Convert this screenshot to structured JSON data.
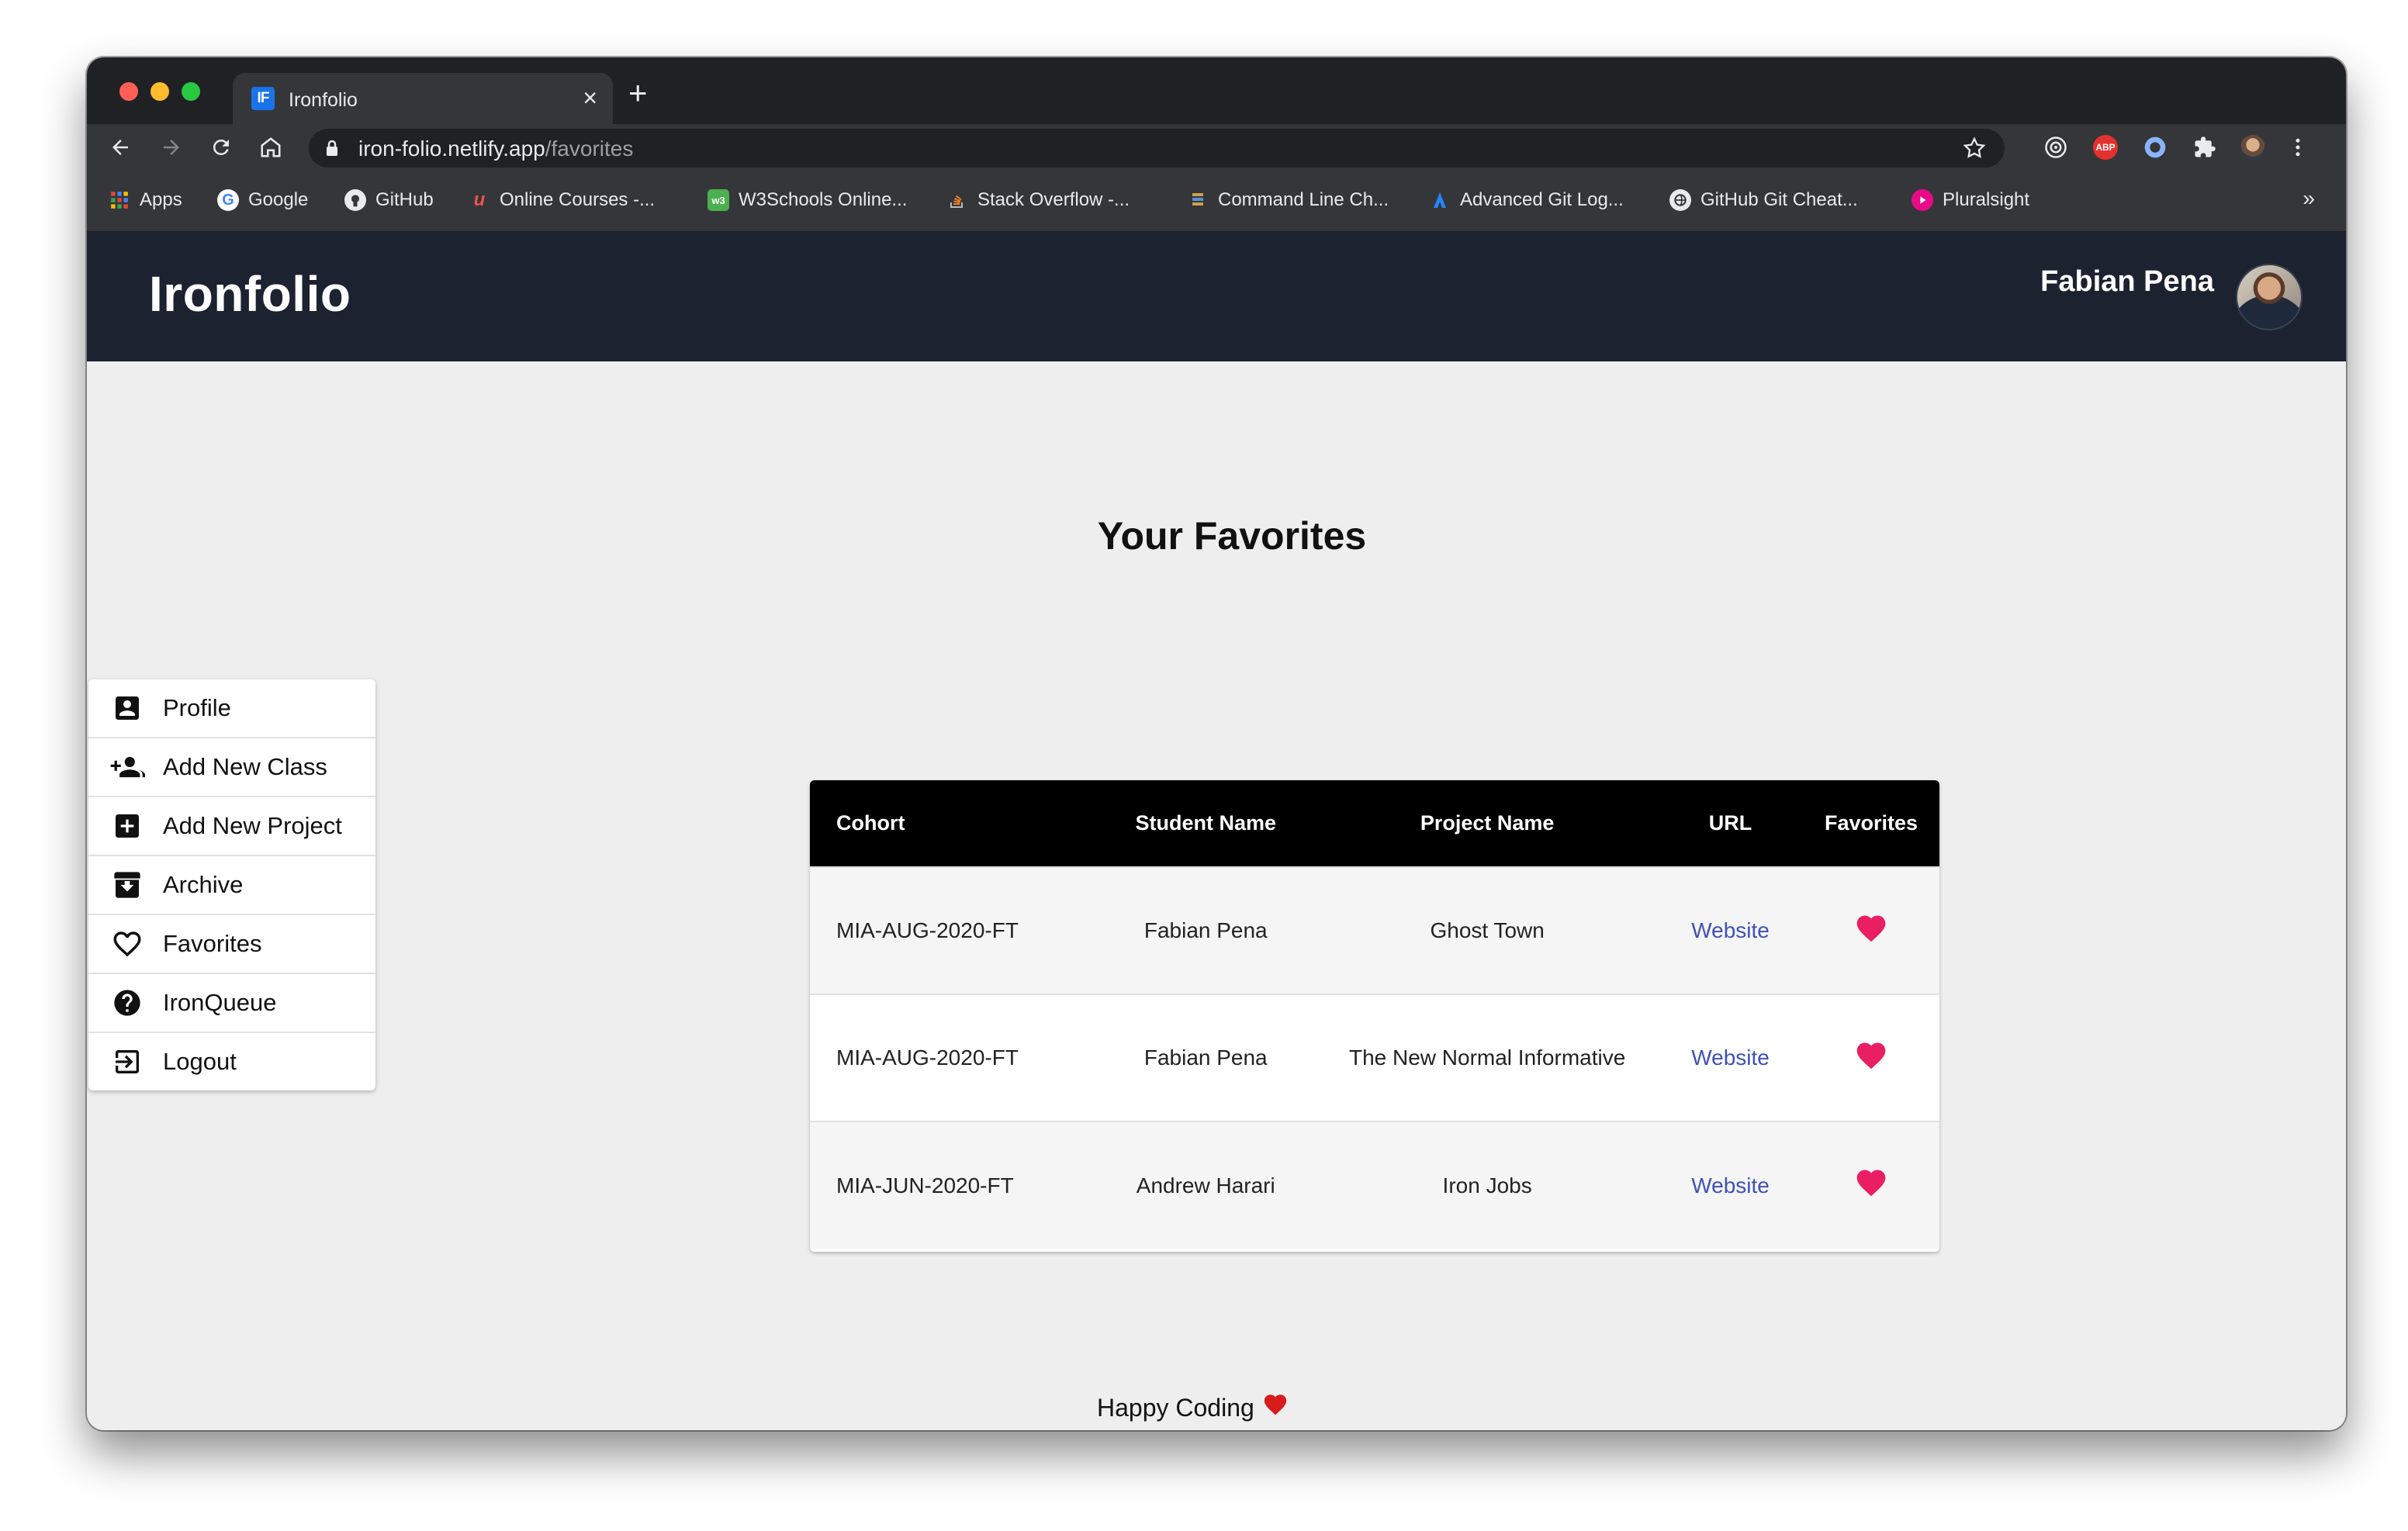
{
  "browser": {
    "tab_title": "Ironfolio",
    "tab_favicon_text": "IF",
    "url_host": "iron-folio.netlify.app",
    "url_path": "/favorites",
    "bookmarks": [
      {
        "label": "Apps",
        "icon": "apps-grid-icon"
      },
      {
        "label": "Google",
        "icon": "google-icon"
      },
      {
        "label": "GitHub",
        "icon": "github-icon"
      },
      {
        "label": "Online Courses -...",
        "icon": "udemy-icon"
      },
      {
        "label": "W3Schools Online...",
        "icon": "w3schools-icon"
      },
      {
        "label": "Stack Overflow -...",
        "icon": "stackoverflow-icon"
      },
      {
        "label": "Command Line Ch...",
        "icon": "command-line-icon"
      },
      {
        "label": "Advanced Git Log...",
        "icon": "atlassian-icon"
      },
      {
        "label": "GitHub Git Cheat...",
        "icon": "github-globe-icon"
      },
      {
        "label": "Pluralsight",
        "icon": "pluralsight-icon"
      }
    ],
    "bookmarks_overflow": "»",
    "extension_abp": "ABP"
  },
  "header": {
    "brand": "Ironfolio",
    "user_name": "Fabian Pena"
  },
  "sidebar": {
    "items": [
      {
        "label": "Profile",
        "icon": "profile-icon"
      },
      {
        "label": "Add New Class",
        "icon": "add-group-icon"
      },
      {
        "label": "Add New Project",
        "icon": "add-box-icon"
      },
      {
        "label": "Archive",
        "icon": "archive-icon"
      },
      {
        "label": "Favorites",
        "icon": "heart-outline-icon"
      },
      {
        "label": "IronQueue",
        "icon": "help-icon"
      },
      {
        "label": "Logout",
        "icon": "logout-icon"
      }
    ]
  },
  "main": {
    "title": "Your Favorites",
    "table": {
      "columns": [
        "Cohort",
        "Student Name",
        "Project Name",
        "URL",
        "Favorites"
      ],
      "rows": [
        {
          "cohort": "MIA-AUG-2020-FT",
          "student": "Fabian Pena",
          "project": "Ghost Town",
          "url": "Website",
          "favorite": true
        },
        {
          "cohort": "MIA-AUG-2020-FT",
          "student": "Fabian Pena",
          "project": "The New Normal Informative",
          "url": "Website",
          "favorite": true
        },
        {
          "cohort": "MIA-JUN-2020-FT",
          "student": "Andrew Harari",
          "project": "Iron Jobs",
          "url": "Website",
          "favorite": true
        }
      ]
    }
  },
  "footer": {
    "text": "Happy Coding"
  },
  "colors": {
    "header_bg": "#1c2230",
    "heart": "#e91e63",
    "link": "#3f51b5"
  }
}
